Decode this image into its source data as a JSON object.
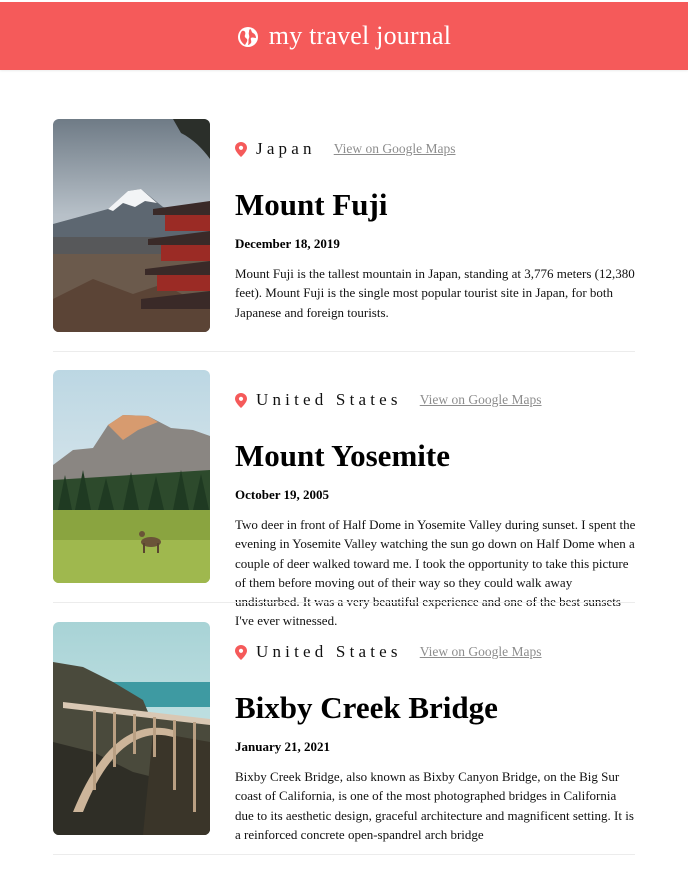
{
  "header": {
    "title": "my travel journal",
    "icon": "globe-icon",
    "color": "#f55a5a"
  },
  "entries": [
    {
      "location": "Japan",
      "map_link": "View on Google Maps",
      "title": "Mount Fuji",
      "date": "December 18, 2019",
      "description": "Mount Fuji is the tallest mountain in Japan, standing at 3,776 meters (12,380 feet). Mount Fuji is the single most popular tourist site in Japan, for both Japanese and foreign tourists."
    },
    {
      "location": "United States",
      "map_link": "View on Google Maps",
      "title": "Mount Yosemite",
      "date": "October 19, 2005",
      "description": "Two deer in front of Half Dome in Yosemite Valley during sunset. I spent the evening in Yosemite Valley watching the sun go down on Half Dome when a couple of deer walked toward me. I took the opportunity to take this picture of them before moving out of their way so they could walk away undisturbed. It was a very beautiful experience and one of the best sunsets I've ever witnessed."
    },
    {
      "location": "United States",
      "map_link": "View on Google Maps",
      "title": "Bixby Creek Bridge",
      "date": "January 21, 2021",
      "description": "Bixby Creek Bridge, also known as Bixby Canyon Bridge, on the Big Sur coast of California, is one of the most photographed bridges in California due to its aesthetic design, graceful architecture and magnificent setting. It is a reinforced concrete open-spandrel arch bridge"
    }
  ]
}
